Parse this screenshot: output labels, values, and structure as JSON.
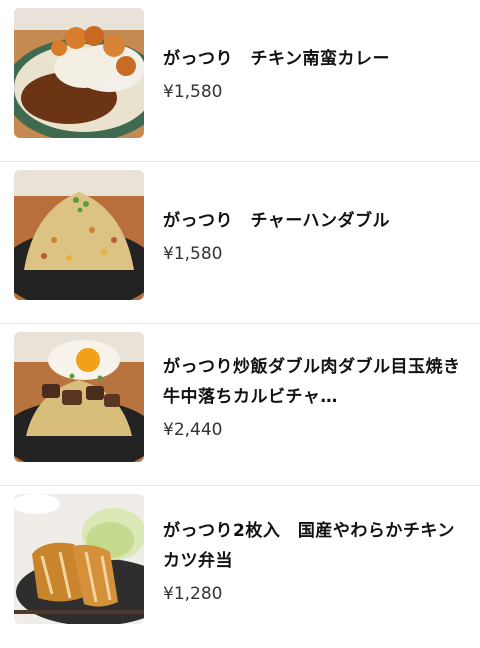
{
  "items": [
    {
      "name": "がっつり　チキン南蛮カレー",
      "price": "¥1,580",
      "image": "chicken-nanban-curry-photo"
    },
    {
      "name": "がっつり　チャーハンダブル",
      "price": "¥1,580",
      "image": "fried-rice-double-photo"
    },
    {
      "name": "がっつり炒飯ダブル肉ダブル目玉焼き　牛中落ちカルビチャ…",
      "price": "¥2,440",
      "image": "fried-rice-beef-egg-photo"
    },
    {
      "name": "がっつり2枚入　国産やわらかチキンカツ弁当",
      "price": "¥1,280",
      "image": "chicken-katsu-bento-photo"
    }
  ]
}
